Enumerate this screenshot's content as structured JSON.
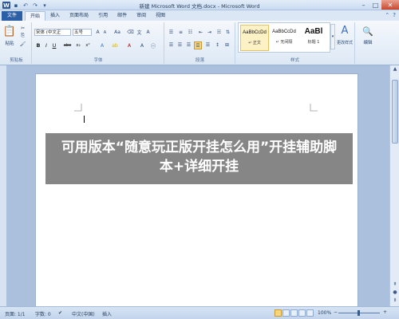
{
  "window": {
    "title": "新建 Microsoft Word 文档.docx - Microsoft Word"
  },
  "quick_access": {
    "app_icon": "W",
    "save_icon": "save-icon",
    "undo_icon": "undo-icon",
    "redo_icon": "redo-icon"
  },
  "tabs": [
    {
      "label": "文件"
    },
    {
      "label": "开始"
    },
    {
      "label": "插入"
    },
    {
      "label": "页面布局"
    },
    {
      "label": "引用"
    },
    {
      "label": "邮件"
    },
    {
      "label": "审阅"
    },
    {
      "label": "视图"
    }
  ],
  "ribbon": {
    "clipboard": {
      "paste_label": "粘贴",
      "group_label": "剪贴板"
    },
    "font": {
      "font_name": "宋体 (中文正",
      "font_size": "五号",
      "group_label": "字体",
      "buttons": [
        "B",
        "I",
        "U",
        "abe",
        "x₂",
        "x²"
      ]
    },
    "paragraph": {
      "group_label": "段落"
    },
    "styles": {
      "group_label": "样式",
      "items": [
        {
          "sample": "AaBbCcDd",
          "name": "↵ 正文"
        },
        {
          "sample": "AaBbCcDd",
          "name": "↵ 无间隔"
        },
        {
          "sample": "AaBl",
          "name": "标题 1"
        }
      ],
      "change_styles": "更改样式"
    },
    "editing": {
      "label": "编辑"
    }
  },
  "banner": {
    "text": "可用版本“随意玩正版开挂怎么用”开挂辅助脚本+详细开挂"
  },
  "status": {
    "page": "页面: 1/1",
    "words": "字数: 0",
    "language": "中文(中国)",
    "mode": "插入",
    "zoom": "100%"
  },
  "colors": {
    "file_tab": "#2b5fa6",
    "banner_bg": "#7d7d7d",
    "workspace_bg": "#abc0dc"
  }
}
